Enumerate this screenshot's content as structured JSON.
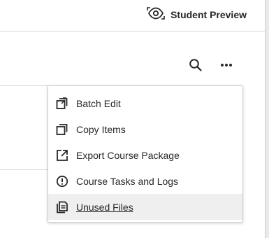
{
  "header": {
    "student_preview_label": "Student Preview"
  },
  "toolbar": {
    "search_icon": "search-icon",
    "more_icon": "more-options-icon"
  },
  "menu": {
    "items": [
      {
        "label": "Batch Edit",
        "icon": "batch-edit-icon"
      },
      {
        "label": "Copy Items",
        "icon": "copy-icon"
      },
      {
        "label": "Export Course Package",
        "icon": "export-icon"
      },
      {
        "label": "Course Tasks and Logs",
        "icon": "alert-circle-icon"
      },
      {
        "label": "Unused Files",
        "icon": "files-icon",
        "state": "hovered"
      }
    ]
  },
  "colors": {
    "text": "#262626",
    "menu_hover_bg": "#efefef",
    "border": "#cfcfcf"
  }
}
